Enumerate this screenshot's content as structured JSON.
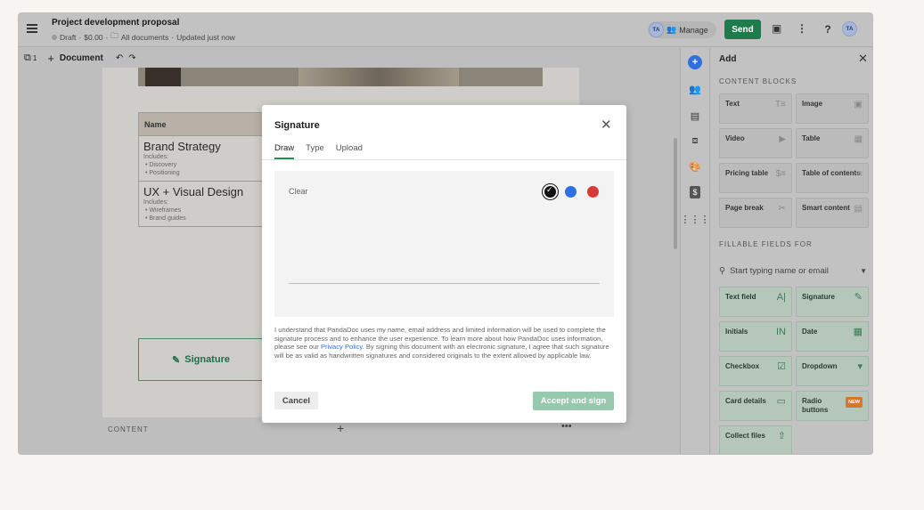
{
  "header": {
    "title": "Project development proposal",
    "status": "Draft",
    "price": "$0.00",
    "folder": "All documents",
    "updated": "Updated just now",
    "avatar_initials": "TA",
    "manage_label": "Manage",
    "send_label": "Send",
    "help_label": "?"
  },
  "toolbar": {
    "pages_count": "1",
    "document_label": "Document"
  },
  "document": {
    "table_header": "Name",
    "rows": [
      {
        "title": "Brand Strategy",
        "includes": "Includes:",
        "items": [
          "Discovery",
          "Positioning"
        ]
      },
      {
        "title": "UX + Visual Design",
        "includes": "Includes:",
        "items": [
          "Wireframes",
          "Brand guides"
        ]
      }
    ],
    "signature_label": "Signature",
    "content_label": "CONTENT"
  },
  "panel": {
    "title": "Add",
    "content_blocks_label": "CONTENT BLOCKS",
    "blocks": [
      {
        "label": "Text",
        "icon": "T≡"
      },
      {
        "label": "Image",
        "icon": "▣"
      },
      {
        "label": "Video",
        "icon": "▶"
      },
      {
        "label": "Table",
        "icon": "▦"
      },
      {
        "label": "Pricing table",
        "icon": "$≡"
      },
      {
        "label": "Table of contents",
        "icon": "≡"
      },
      {
        "label": "Page break",
        "icon": "✂"
      },
      {
        "label": "Smart content",
        "icon": "▤"
      }
    ],
    "fillable_label": "FILLABLE FIELDS FOR",
    "search_placeholder": "Start typing name or email",
    "fields": [
      {
        "label": "Text field",
        "icon": "A|"
      },
      {
        "label": "Signature",
        "icon": "✎"
      },
      {
        "label": "Initials",
        "icon": "IN"
      },
      {
        "label": "Date",
        "icon": "▦"
      },
      {
        "label": "Checkbox",
        "icon": "☑"
      },
      {
        "label": "Dropdown",
        "icon": "▾"
      },
      {
        "label": "Card details",
        "icon": "▭"
      },
      {
        "label": "Radio buttons",
        "icon": "",
        "badge": "NEW"
      },
      {
        "label": "Collect files",
        "icon": "⇧"
      }
    ]
  },
  "modal": {
    "title": "Signature",
    "tabs": [
      "Draw",
      "Type",
      "Upload"
    ],
    "active_tab": "Draw",
    "clear_label": "Clear",
    "colors": {
      "black": "#111111",
      "blue": "#2f6fdf",
      "red": "#d83a3a"
    },
    "legal_before": "I understand that PandaDoc uses my name, email address and limited information will be used to complete the signature process and to enhance the user experience. To learn more about how PandaDoc uses information, please see our ",
    "legal_link": "Privacy Policy",
    "legal_after": ". By signing this document with an electronic signature, I agree that such signature will be as valid as handwritten signatures and considered originals to the extent allowed by applicable law.",
    "cancel_label": "Cancel",
    "accept_label": "Accept and sign"
  }
}
